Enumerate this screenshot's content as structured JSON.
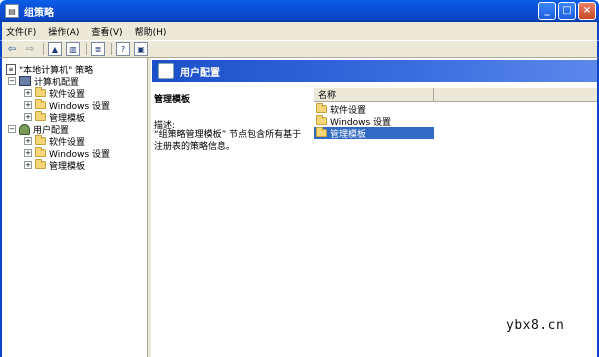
{
  "window": {
    "title": "组策略",
    "minimize": "_",
    "maximize": "□",
    "close": "×"
  },
  "menu": [
    "文件(F)",
    "操作(A)",
    "查看(V)",
    "帮助(H)"
  ],
  "toolbar": [
    "back-arrow-icon",
    "forward-arrow-icon",
    "up-folder-icon",
    "show-tree-icon",
    "export-list-icon",
    "properties-icon",
    "help-icon"
  ],
  "tree": {
    "root": "\"本地计算机\" 策略",
    "computer": "计算机配置",
    "computer_children": [
      "软件设置",
      "Windows 设置",
      "管理模板"
    ],
    "user": "用户配置",
    "user_children": [
      "软件设置",
      "Windows 设置",
      "管理模板"
    ]
  },
  "header": {
    "title": "用户配置"
  },
  "detail": {
    "heading": "管理模板",
    "label": "描述:",
    "text": "“组策略管理模板” 节点包含所有基于注册表的策略信息。"
  },
  "list": {
    "column": "名称",
    "items": [
      "软件设置",
      "Windows 设置",
      "管理模板"
    ],
    "selected_index": 2
  },
  "watermark": "ybx8.cn"
}
